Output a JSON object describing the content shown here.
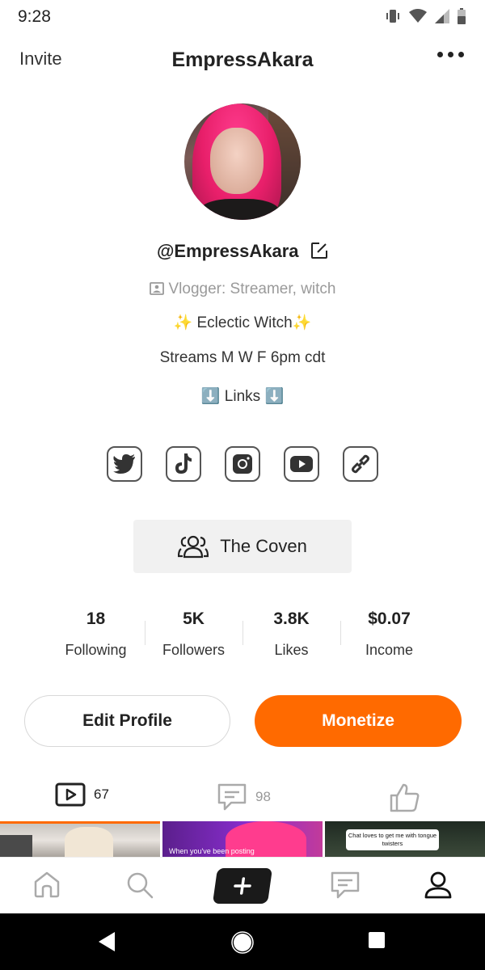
{
  "status_bar": {
    "time": "9:28"
  },
  "header": {
    "invite": "Invite",
    "title": "EmpressAkara"
  },
  "profile": {
    "handle": "@EmpressAkara",
    "category": "Vlogger: Streamer, witch",
    "bio": [
      "✨ Eclectic Witch✨",
      "Streams M W F 6pm cdt",
      "⬇️ Links ⬇️"
    ]
  },
  "socials": [
    "twitter-icon",
    "tiktok-icon",
    "instagram-icon",
    "youtube-icon",
    "link-icon"
  ],
  "community": {
    "label": "The Coven"
  },
  "stats": [
    {
      "value": "18",
      "label": "Following"
    },
    {
      "value": "5K",
      "label": "Followers"
    },
    {
      "value": "3.8K",
      "label": "Likes"
    },
    {
      "value": "$0.07",
      "label": "Income"
    }
  ],
  "buttons": {
    "edit": "Edit Profile",
    "monetize": "Monetize"
  },
  "tabs": {
    "videos_count": "67",
    "comments_count": "98"
  },
  "thumbnails": {
    "caption_2": "When you've been posting",
    "caption_3": "Chat loves to get me with tongue twisters"
  },
  "colors": {
    "accent": "#ff6a00"
  }
}
